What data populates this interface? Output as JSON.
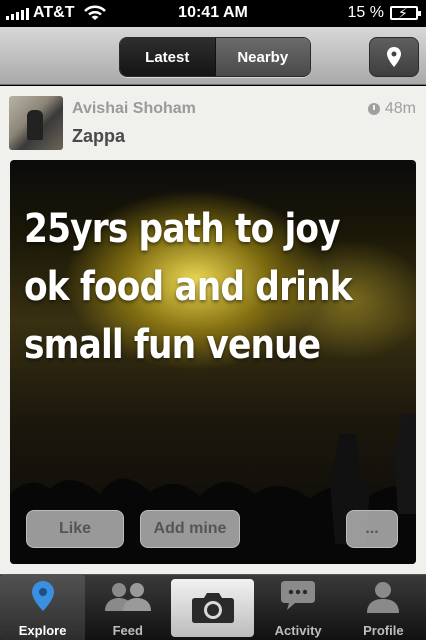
{
  "status_bar": {
    "carrier": "AT&T",
    "time": "10:41 AM",
    "battery": "15 %"
  },
  "nav": {
    "segments": [
      {
        "label": "Latest",
        "active": true
      },
      {
        "label": "Nearby",
        "active": false
      }
    ],
    "location_icon": "location-pin-icon"
  },
  "post": {
    "author": "Avishai Shoham",
    "place": "Zappa",
    "time_ago": "48m",
    "text_lines": [
      "25yrs path to joy",
      "ok food and drink",
      "small fun venue"
    ],
    "buttons": {
      "like": "Like",
      "add_mine": "Add mine",
      "more": "..."
    }
  },
  "tabs": [
    {
      "label": "Explore",
      "icon": "location-pin-icon",
      "active": true
    },
    {
      "label": "Feed",
      "icon": "people-icon",
      "active": false
    },
    {
      "label": "",
      "icon": "camera-icon",
      "active": false
    },
    {
      "label": "Activity",
      "icon": "speech-bubble-icon",
      "active": false
    },
    {
      "label": "Profile",
      "icon": "person-icon",
      "active": false
    }
  ],
  "colors": {
    "accent_blue": "#3b8fe0",
    "background": "#f0f0ec"
  }
}
